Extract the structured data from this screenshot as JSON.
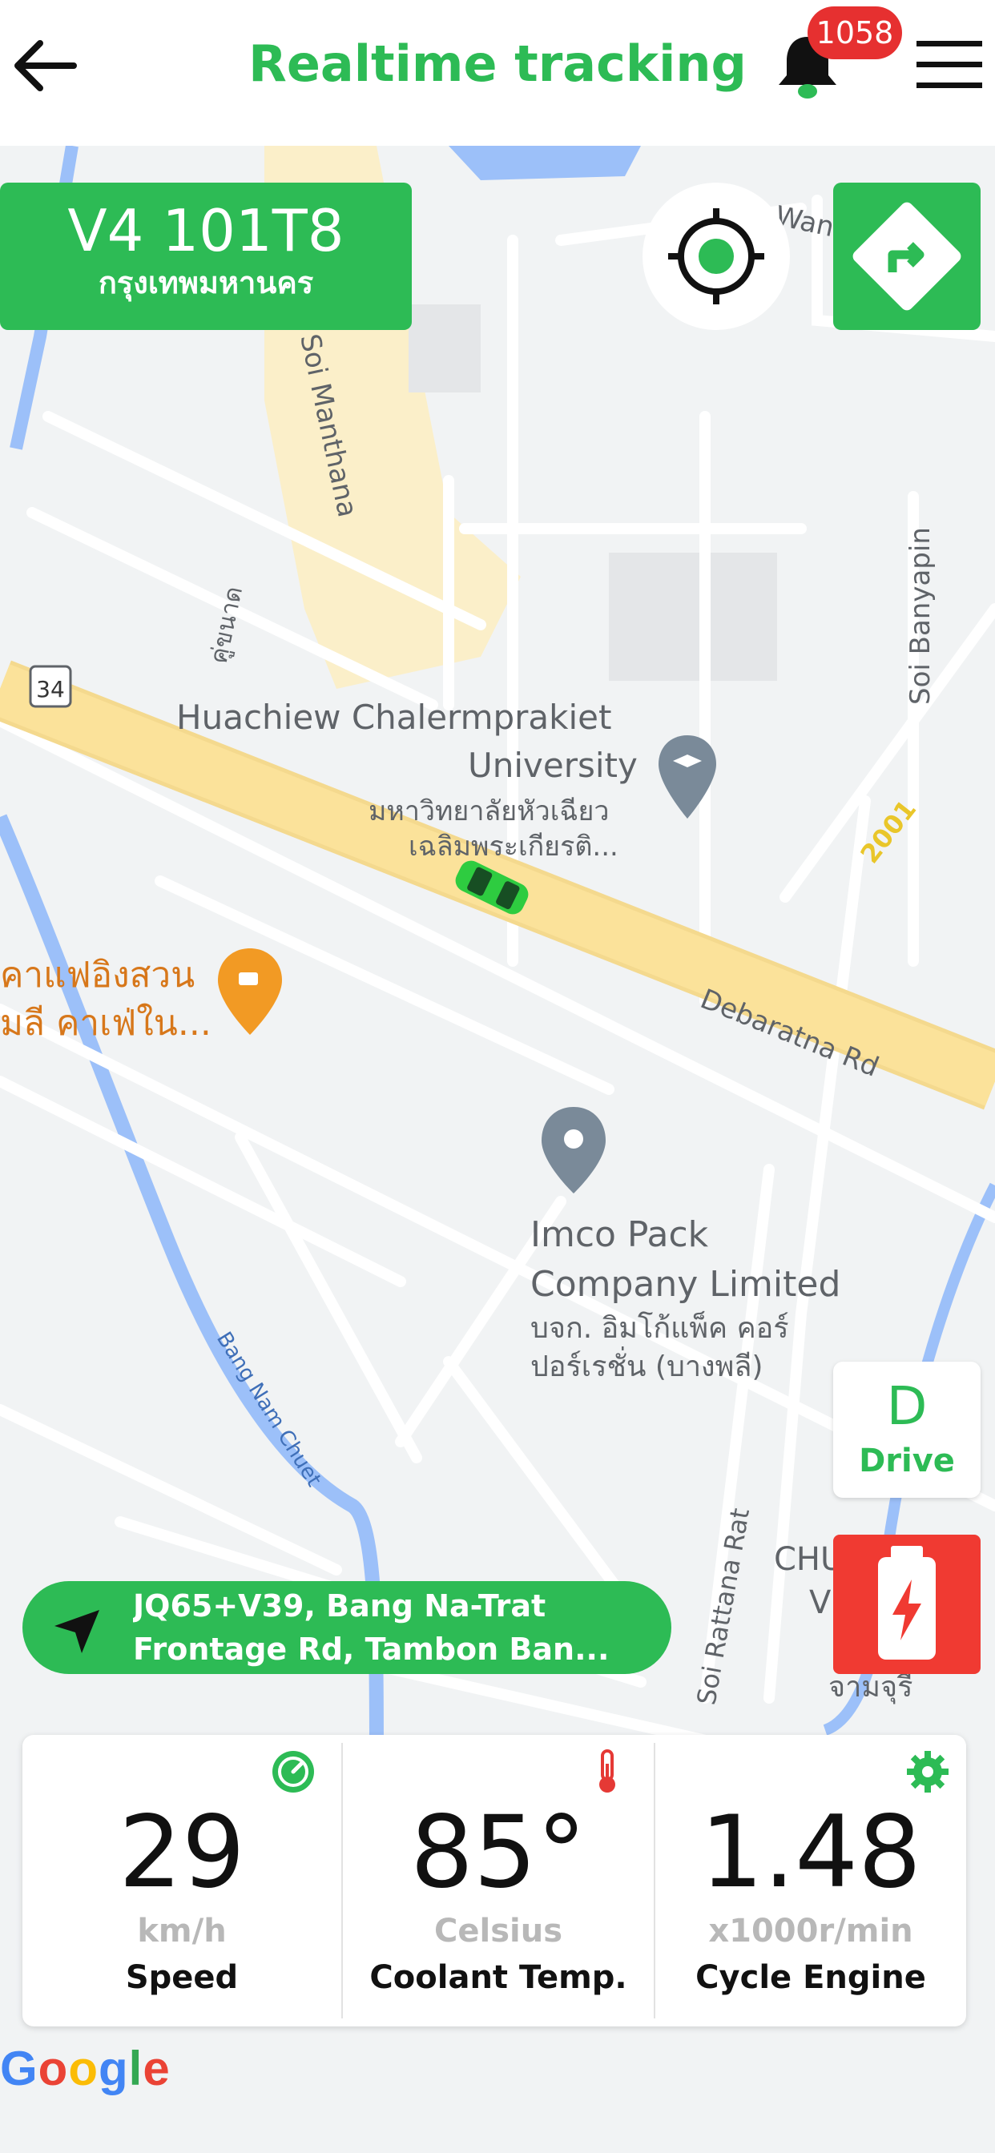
{
  "header": {
    "title": "Realtime tracking",
    "notification_count": "1058"
  },
  "vehicle": {
    "plate_number": "V4 101T8",
    "province": "กรุงเทพมหานคร"
  },
  "map": {
    "labels": {
      "university_en_1": "Huachiew Chalermprakiet",
      "university_en_2": "University",
      "university_th_1": "มหาวิทยาลัยหัวเฉียว",
      "university_th_2": "เฉลิมพระเกียรติ...",
      "soi_manthana": "Soi Manthana",
      "soi_banyapin": "Soi Banyapin",
      "road_34": "34",
      "khu_khanat": "คู่ขนาด",
      "road_2001": "2001",
      "debaratna": "Debaratna Rd",
      "cafe_1": "คาแฟอิงสวน",
      "cafe_2": "มลี คาเฟ่ใน...",
      "imco_1": "Imco Pack",
      "imco_2": "Company Limited",
      "imco_th_1": "บจก. อิมโก้แพ็ค คอร์",
      "imco_th_2": "ปอร์เรชั่น (บางพลี)",
      "canal": "Bang Nam Chuet",
      "soi_rattana": "Soi Rattana Rat",
      "chu": "CHU",
      "v": "V",
      "chamchuri": "จามจุรี",
      "wan": "Wan"
    },
    "colors": {
      "land": "#f1f3f4",
      "main_road": "#fbe29a",
      "water": "#9cc0f9",
      "accent": "#2dbb55"
    }
  },
  "gear": {
    "letter": "D",
    "label": "Drive"
  },
  "address": {
    "line1": "JQ65+V39, Bang Na-Trat",
    "line2": "Frontage Rd, Tambon Ban..."
  },
  "stats": [
    {
      "value": "29",
      "unit": "km/h",
      "label": "Speed",
      "icon": "speedometer-icon"
    },
    {
      "value": "85°",
      "unit": "Celsius",
      "label": "Coolant Temp.",
      "icon": "thermometer-icon"
    },
    {
      "value": "1.48",
      "unit": "x1000r/min",
      "label": "Cycle Engine",
      "icon": "gear-icon"
    }
  ],
  "attribution": "Google"
}
